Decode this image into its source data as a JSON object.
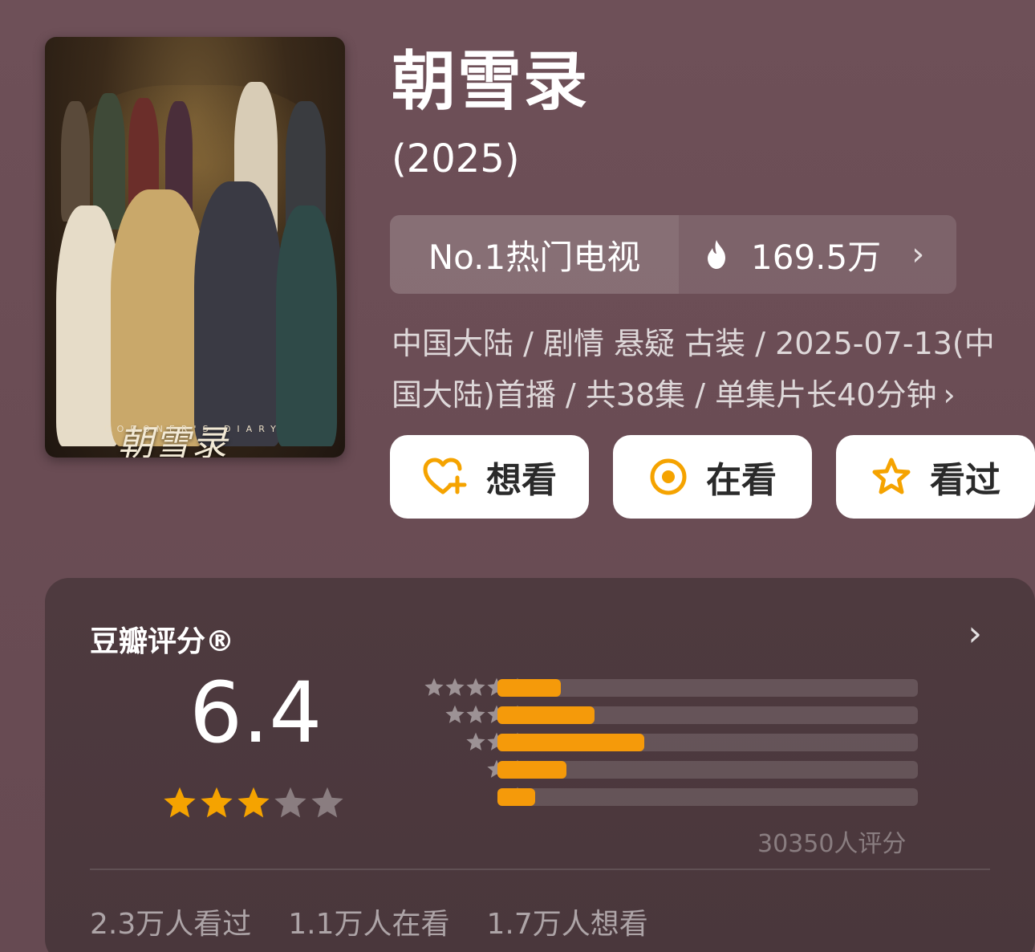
{
  "poster": {
    "calligraphy_title": "朝雪录",
    "english_title": "CORONER'S DIARY"
  },
  "header": {
    "title": "朝雪录",
    "year": "(2025)"
  },
  "rank": {
    "label": "No.1热门电视",
    "heat": "169.5万",
    "flame_icon": "flame-icon",
    "accent": "#ffffff"
  },
  "meta": {
    "line1": "中国大陆 / 剧情 悬疑 古装 / 2025-07-13(中",
    "line2": "国大陆)首播 / 共38集 / 单集片长40分钟"
  },
  "actions": {
    "want_label": "想看",
    "watching_label": "在看",
    "watched_label": "看过",
    "icon_color": "#f5a300"
  },
  "rating": {
    "title": "豆瓣评分®",
    "score": "6.4",
    "stars_filled": 3,
    "stars_total": 5,
    "count_text": "30350人评分",
    "distribution": [
      {
        "stars": 5,
        "fraction": 0.15
      },
      {
        "stars": 4,
        "fraction": 0.23
      },
      {
        "stars": 3,
        "fraction": 0.35
      },
      {
        "stars": 2,
        "fraction": 0.165
      },
      {
        "stars": 1,
        "fraction": 0.09
      }
    ],
    "bar_color": "#f59a0a",
    "star_color": "#f5a300"
  },
  "stats": {
    "watched": "2.3万人看过",
    "watching": "1.1万人在看",
    "want": "1.7万人想看"
  }
}
